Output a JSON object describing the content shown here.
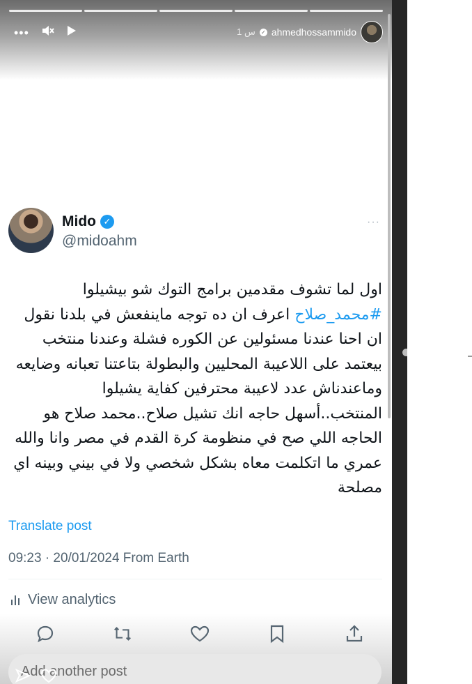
{
  "story": {
    "progress_segments": 5,
    "username": "ahmedhossammido",
    "time": "1 س"
  },
  "tweet": {
    "name": "Mido",
    "handle": "@midoahm",
    "more": "···",
    "text_line1": "اول لما تشوف مقدمين برامج التوك شو بيشيلوا",
    "hashtag": "#محمد_صلاح",
    "text_line2_rest": " اعرف ان ده توجه ماينفعش في بلدنا نقول",
    "text_rest": "ان احنا عندنا مسئولين عن الكوره فشلة وعندنا منتخب بيعتمد على اللاعيبة المحليين والبطولة بتاعتنا تعبانه وضايعه وماعندناش عدد لاعيبة محترفين كفاية يشيلوا المنتخب..أسهل حاجه انك تشيل صلاح..محمد صلاح هو الحاجه اللي صح في منظومة كرة القدم في مصر وانا والله عمري ما اتكلمت معاه بشكل شخصي ولا في بيني وبينه اي مصلحة",
    "translate": "Translate post",
    "meta": "09:23 · 20/01/2024 From Earth",
    "analytics": "View analytics",
    "compose_placeholder": "Add another post"
  },
  "colors": {
    "accent": "#1d9bf0",
    "text": "#0f1419",
    "muted": "#536471"
  },
  "icons": [
    "more-icon",
    "mute-icon",
    "play-icon",
    "verified-icon",
    "reply-icon",
    "repost-icon",
    "like-icon",
    "bookmark-icon",
    "share-icon",
    "analytics-icon",
    "send-icon",
    "heart-outline-icon"
  ]
}
